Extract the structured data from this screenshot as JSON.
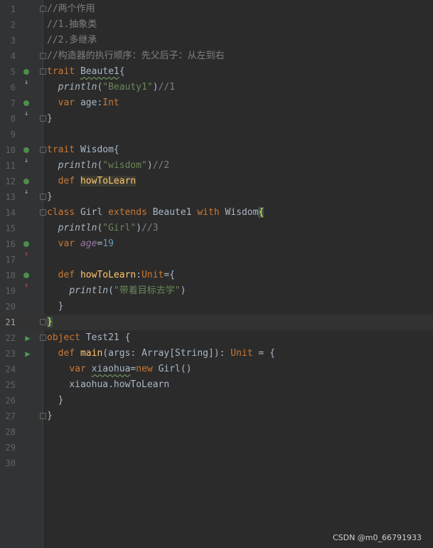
{
  "lines": [
    {
      "n": "1",
      "segs": [
        {
          "t": "//两个作用",
          "c": "comment"
        }
      ]
    },
    {
      "n": "2",
      "segs": [
        {
          "t": "//1.抽象类",
          "c": "comment"
        }
      ]
    },
    {
      "n": "3",
      "segs": [
        {
          "t": "//2.多继承",
          "c": "comment"
        }
      ]
    },
    {
      "n": "4",
      "segs": [
        {
          "t": "//构造器的执行顺序：先父后子：从左到右",
          "c": "comment"
        }
      ]
    },
    {
      "n": "5",
      "segs": [
        {
          "t": "trait ",
          "c": "kw"
        },
        {
          "t": "Beaute1",
          "c": "squiggle"
        },
        {
          "t": "{",
          "c": ""
        }
      ]
    },
    {
      "n": "6",
      "segs": [
        {
          "t": "  ",
          "c": ""
        },
        {
          "t": "println",
          "c": "ital"
        },
        {
          "t": "(",
          "c": ""
        },
        {
          "t": "\"Beauty1\"",
          "c": "str"
        },
        {
          "t": ")",
          "c": ""
        },
        {
          "t": "//1",
          "c": "comment"
        }
      ]
    },
    {
      "n": "7",
      "segs": [
        {
          "t": "  ",
          "c": ""
        },
        {
          "t": "var ",
          "c": "kw"
        },
        {
          "t": "age:",
          "c": ""
        },
        {
          "t": "Int",
          "c": "typ"
        }
      ]
    },
    {
      "n": "8",
      "segs": [
        {
          "t": "}",
          "c": ""
        }
      ]
    },
    {
      "n": "9",
      "segs": []
    },
    {
      "n": "10",
      "segs": [
        {
          "t": "trait ",
          "c": "kw"
        },
        {
          "t": "Wisdom{",
          "c": ""
        }
      ]
    },
    {
      "n": "11",
      "segs": [
        {
          "t": "  ",
          "c": ""
        },
        {
          "t": "println",
          "c": "ital"
        },
        {
          "t": "(",
          "c": ""
        },
        {
          "t": "\"wisdom\"",
          "c": "str"
        },
        {
          "t": ")",
          "c": ""
        },
        {
          "t": "//2",
          "c": "comment"
        }
      ]
    },
    {
      "n": "12",
      "segs": [
        {
          "t": "  ",
          "c": ""
        },
        {
          "t": "def ",
          "c": "kw"
        },
        {
          "t": "howToLearn",
          "c": "fn hl"
        }
      ]
    },
    {
      "n": "13",
      "segs": [
        {
          "t": "}",
          "c": ""
        }
      ]
    },
    {
      "n": "14",
      "segs": [
        {
          "t": "class ",
          "c": "kw"
        },
        {
          "t": "Girl ",
          "c": ""
        },
        {
          "t": "extends ",
          "c": "kw"
        },
        {
          "t": "Beaute1 ",
          "c": ""
        },
        {
          "t": "with ",
          "c": "kw"
        },
        {
          "t": "Wisdom",
          "c": ""
        },
        {
          "t": "{",
          "c": "brace-hl"
        }
      ]
    },
    {
      "n": "15",
      "segs": [
        {
          "t": "  ",
          "c": ""
        },
        {
          "t": "println",
          "c": "ital"
        },
        {
          "t": "(",
          "c": ""
        },
        {
          "t": "\"Girl\"",
          "c": "str"
        },
        {
          "t": ")",
          "c": ""
        },
        {
          "t": "//3",
          "c": "comment"
        }
      ]
    },
    {
      "n": "16",
      "segs": [
        {
          "t": "  ",
          "c": ""
        },
        {
          "t": "var ",
          "c": "kw"
        },
        {
          "t": "age",
          "c": "field"
        },
        {
          "t": "=",
          "c": ""
        },
        {
          "t": "19",
          "c": "num"
        }
      ]
    },
    {
      "n": "17",
      "segs": []
    },
    {
      "n": "18",
      "segs": [
        {
          "t": "  ",
          "c": ""
        },
        {
          "t": "def ",
          "c": "kw"
        },
        {
          "t": "howToLearn",
          "c": "fn"
        },
        {
          "t": ":",
          "c": ""
        },
        {
          "t": "Unit",
          "c": "typ"
        },
        {
          "t": "={",
          "c": ""
        }
      ]
    },
    {
      "n": "19",
      "segs": [
        {
          "t": "    ",
          "c": ""
        },
        {
          "t": "println",
          "c": "ital"
        },
        {
          "t": "(",
          "c": ""
        },
        {
          "t": "\"带着目标去学\"",
          "c": "str"
        },
        {
          "t": ")",
          "c": ""
        }
      ]
    },
    {
      "n": "20",
      "segs": [
        {
          "t": "  }",
          "c": ""
        }
      ]
    },
    {
      "n": "21",
      "segs": [
        {
          "t": "}",
          "c": "brace-hl"
        }
      ]
    },
    {
      "n": "22",
      "segs": [
        {
          "t": "object ",
          "c": "kw"
        },
        {
          "t": "Test21 {",
          "c": ""
        }
      ]
    },
    {
      "n": "23",
      "segs": [
        {
          "t": "  ",
          "c": ""
        },
        {
          "t": "def ",
          "c": "kw"
        },
        {
          "t": "main",
          "c": "fn"
        },
        {
          "t": "(args: Array[String]): ",
          "c": ""
        },
        {
          "t": "Unit",
          "c": "typ"
        },
        {
          "t": " = {",
          "c": ""
        }
      ]
    },
    {
      "n": "24",
      "segs": [
        {
          "t": "    ",
          "c": ""
        },
        {
          "t": "var ",
          "c": "kw"
        },
        {
          "t": "xiaohua",
          "c": "squiggle"
        },
        {
          "t": "=",
          "c": ""
        },
        {
          "t": "new ",
          "c": "kw"
        },
        {
          "t": "Girl()",
          "c": ""
        }
      ]
    },
    {
      "n": "25",
      "segs": [
        {
          "t": "    xiaohua.howToLearn",
          "c": ""
        }
      ]
    },
    {
      "n": "26",
      "segs": [
        {
          "t": "  }",
          "c": ""
        }
      ]
    },
    {
      "n": "27",
      "segs": [
        {
          "t": "}",
          "c": ""
        }
      ]
    },
    {
      "n": "28",
      "segs": []
    },
    {
      "n": "29",
      "segs": []
    },
    {
      "n": "30",
      "segs": []
    }
  ],
  "markers": {
    "5": "impl-down",
    "7": "impl-down",
    "10": "impl-down",
    "12": "impl-down",
    "16": "impl-up",
    "18": "impl-up",
    "22": "run",
    "23": "run"
  },
  "folds": [
    "1",
    "4",
    "5",
    "8",
    "10",
    "13",
    "14",
    "21",
    "22",
    "27"
  ],
  "current_line": "21",
  "watermark": "CSDN @m0_66791933"
}
